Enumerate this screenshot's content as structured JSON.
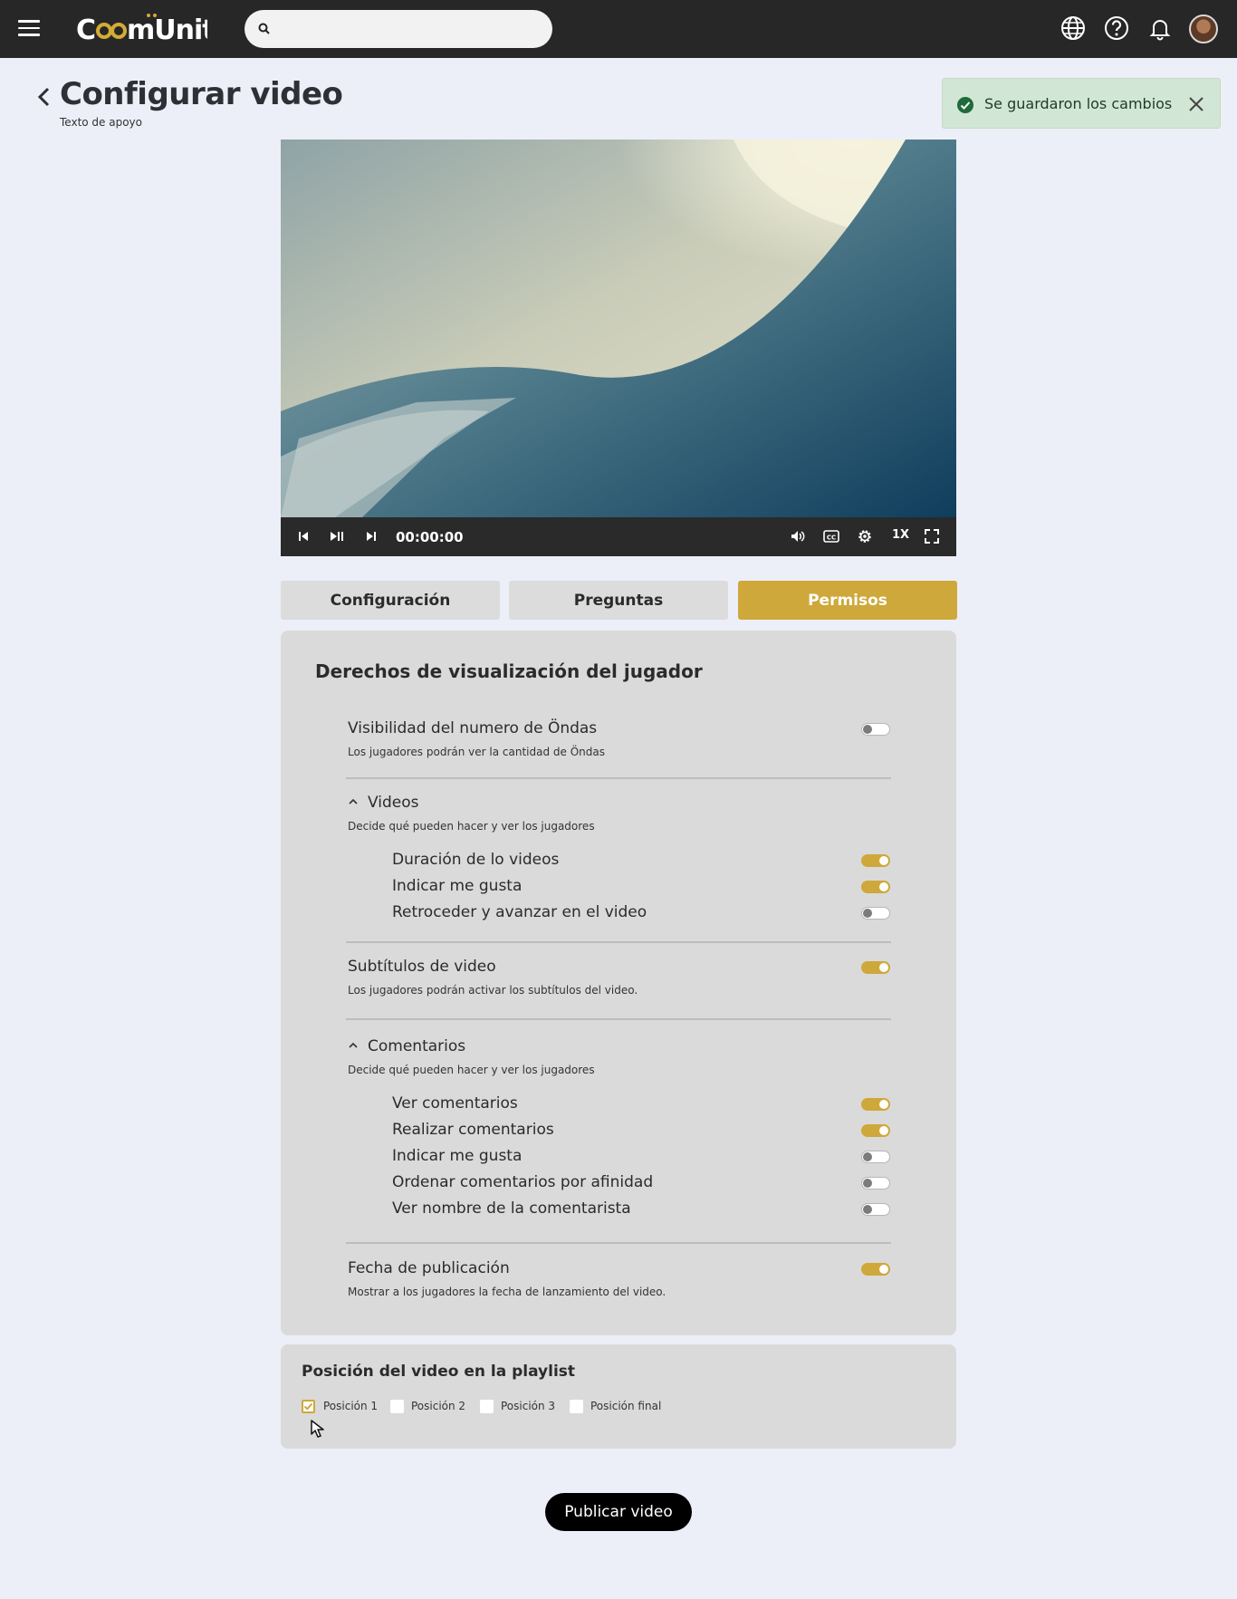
{
  "app": {
    "logo_text": "CoomÜnity",
    "search_placeholder": "",
    "accent_color": "#cea83a"
  },
  "header": {
    "title": "Configurar video",
    "subtitle": "Texto de apoyo"
  },
  "toast": {
    "message": "Se guardaron los cambios"
  },
  "player": {
    "time": "00:00:00",
    "speed": "1X"
  },
  "tabs": [
    {
      "label": "Configuración",
      "active": false
    },
    {
      "label": "Preguntas",
      "active": false
    },
    {
      "label": "Permisos",
      "active": true
    }
  ],
  "permissions": {
    "title": "Derechos de visualización del jugador",
    "ondas": {
      "label": "Visibilidad  del numero de Öndas",
      "desc": "Los jugadores podrán ver la cantidad de Öndas",
      "on": false
    },
    "videos": {
      "label": "Videos",
      "desc": "Decide qué pueden hacer y ver los jugadores",
      "items": [
        {
          "label": "Duración de lo videos",
          "on": true
        },
        {
          "label": "Indicar me gusta",
          "on": true
        },
        {
          "label": "Retroceder y avanzar en el video",
          "on": false
        }
      ]
    },
    "subtitles": {
      "label": "Subtítulos de video",
      "desc": "Los jugadores podrán activar los subtítulos del video.",
      "on": true
    },
    "comments": {
      "label": "Comentarios",
      "desc": "Decide qué pueden hacer y ver los jugadores",
      "items": [
        {
          "label": "Ver comentarios",
          "on": true
        },
        {
          "label": "Realizar comentarios",
          "on": true
        },
        {
          "label": "Indicar me gusta",
          "on": false
        },
        {
          "label": "Ordenar comentarios por afinidad",
          "on": false
        },
        {
          "label": "Ver nombre de la comentarista",
          "on": false
        }
      ]
    },
    "publish_date": {
      "label": "Fecha de publicación",
      "desc": "Mostrar a los jugadores la fecha de lanzamiento del video.",
      "on": true
    }
  },
  "playlist": {
    "title": "Posición del video en la playlist",
    "options": [
      {
        "label": "Posición 1",
        "checked": true
      },
      {
        "label": "Posición 2",
        "checked": false
      },
      {
        "label": "Posición 3",
        "checked": false
      },
      {
        "label": "Posición final",
        "checked": false
      }
    ]
  },
  "publish_button": "Publicar video"
}
